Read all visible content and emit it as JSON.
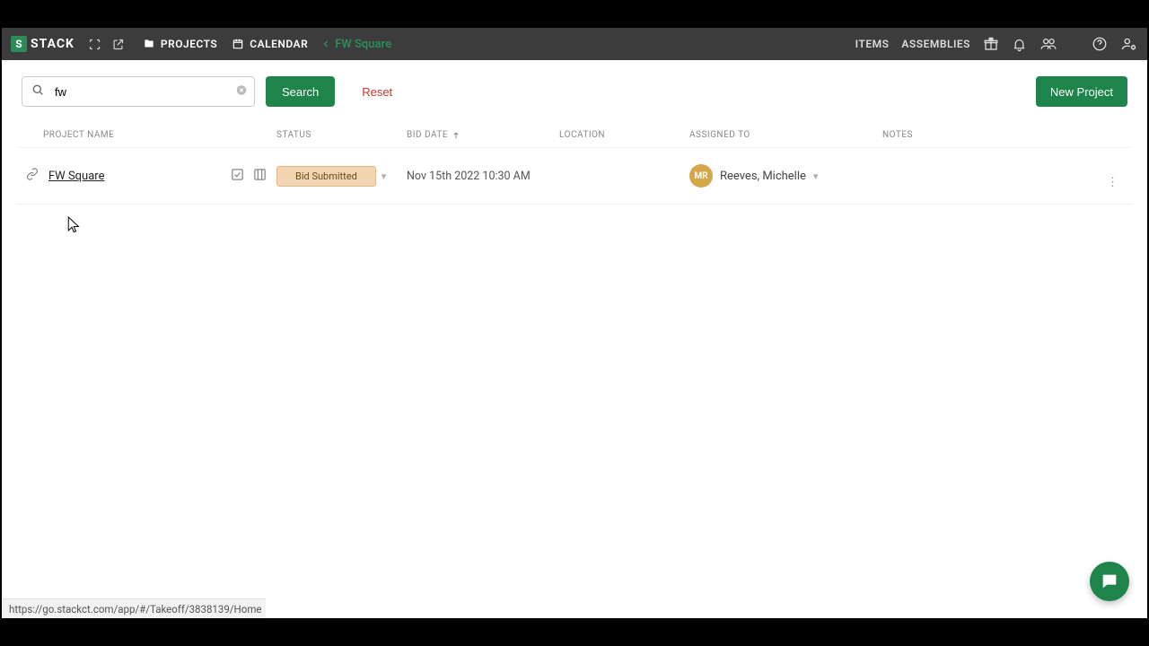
{
  "brand": {
    "text": "STACK",
    "mark": "S"
  },
  "nav": {
    "projects": "PROJECTS",
    "calendar": "CALENDAR",
    "breadcrumb": "FW Square",
    "items": "ITEMS",
    "assemblies": "ASSEMBLIES"
  },
  "toolbar": {
    "search_value": "fw",
    "search_button": "Search",
    "reset_button": "Reset",
    "new_project": "New Project"
  },
  "columns": {
    "name": "PROJECT NAME",
    "status": "STATUS",
    "bid": "BID DATE",
    "location": "LOCATION",
    "assigned": "ASSIGNED TO",
    "notes": "NOTES"
  },
  "rows": [
    {
      "name": "FW Square",
      "status": "Bid Submitted",
      "bid_date": "Nov 15th 2022 10:30 AM",
      "location": "",
      "assigned_initials": "MR",
      "assigned_name": "Reeves, Michelle",
      "notes": ""
    }
  ],
  "status_url": "https://go.stackct.com/app/#/Takeoff/3838139/Home"
}
